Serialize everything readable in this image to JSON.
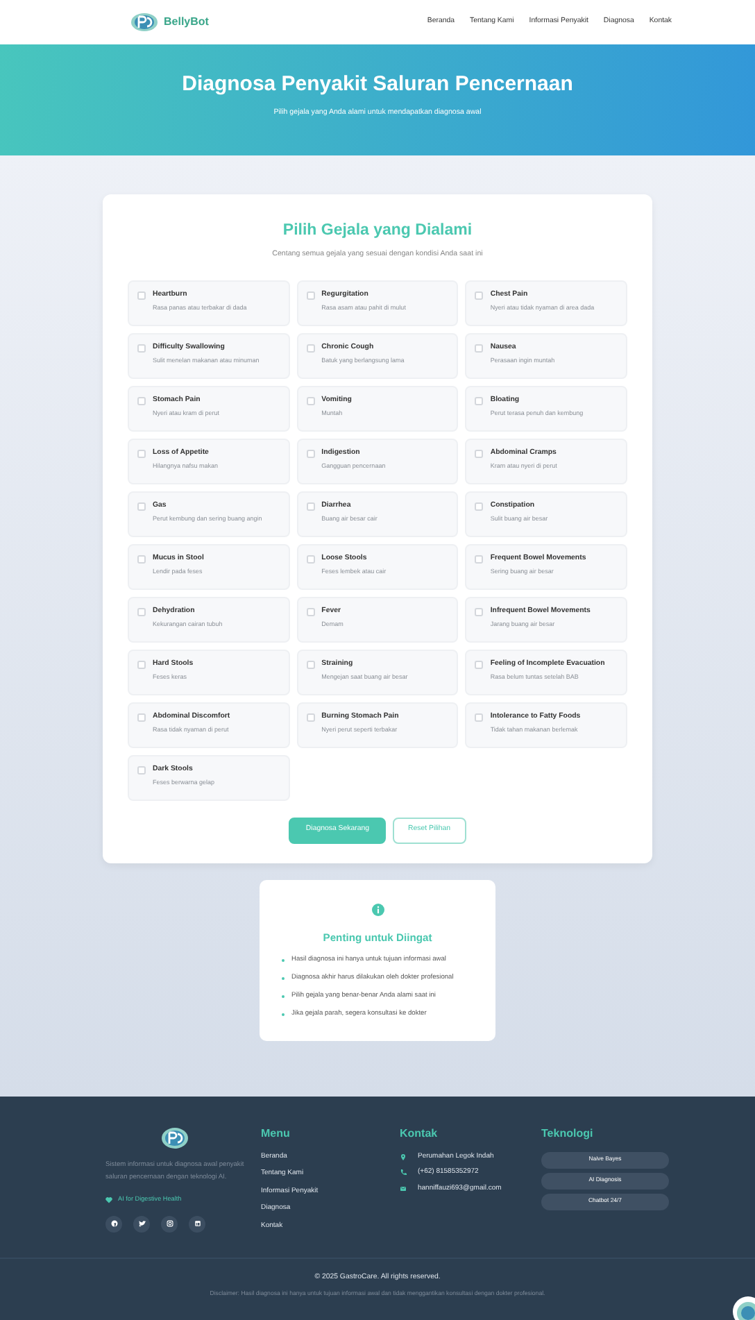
{
  "navbar": {
    "brand": "BellyBot",
    "links": [
      {
        "label": "Beranda",
        "selected": false
      },
      {
        "label": "Tentang Kami",
        "selected": false
      },
      {
        "label": "Informasi Penyakit",
        "selected": false
      },
      {
        "label": "Diagnosa",
        "selected": false
      },
      {
        "label": "Kontak",
        "selected": false
      }
    ]
  },
  "hero": {
    "title": "Diagnosa Penyakit Saluran Pencernaan",
    "subtitle": "Pilih gejala yang Anda alami untuk mendapatkan diagnosa awal"
  },
  "symptom_card": {
    "title": "Pilih Gejala yang Dialami",
    "subtitle": "Centang semua gejala yang sesuai dengan kondisi Anda saat ini",
    "symptoms": [
      {
        "name": "Heartburn",
        "description": "Rasa panas atau terbakar di dada",
        "checked": false
      },
      {
        "name": "Regurgitation",
        "description": "Rasa asam atau pahit di mulut",
        "checked": false
      },
      {
        "name": "Chest Pain",
        "description": "Nyeri atau tidak nyaman di area dada",
        "checked": false
      },
      {
        "name": "Difficulty Swallowing",
        "description": "Sulit menelan makanan atau minuman",
        "checked": false
      },
      {
        "name": "Chronic Cough",
        "description": "Batuk yang berlangsung lama",
        "checked": false
      },
      {
        "name": "Nausea",
        "description": "Perasaan ingin muntah",
        "checked": false
      },
      {
        "name": "Stomach Pain",
        "description": "Nyeri atau kram di perut",
        "checked": false
      },
      {
        "name": "Vomiting",
        "description": "Muntah",
        "checked": false
      },
      {
        "name": "Bloating",
        "description": "Perut terasa penuh dan kembung",
        "checked": false
      },
      {
        "name": "Loss of Appetite",
        "description": "Hilangnya nafsu makan",
        "checked": false
      },
      {
        "name": "Indigestion",
        "description": "Gangguan pencernaan",
        "checked": false
      },
      {
        "name": "Abdominal Cramps",
        "description": "Kram atau nyeri di perut",
        "checked": false
      },
      {
        "name": "Gas",
        "description": "Perut kembung dan sering buang angin",
        "checked": false
      },
      {
        "name": "Diarrhea",
        "description": "Buang air besar cair",
        "checked": false
      },
      {
        "name": "Constipation",
        "description": "Sulit buang air besar",
        "checked": false
      },
      {
        "name": "Mucus in Stool",
        "description": "Lendir pada feses",
        "checked": false
      },
      {
        "name": "Loose Stools",
        "description": "Feses lembek atau cair",
        "checked": false
      },
      {
        "name": "Frequent Bowel Movements",
        "description": "Sering buang air besar",
        "checked": false
      },
      {
        "name": "Dehydration",
        "description": "Kekurangan cairan tubuh",
        "checked": false
      },
      {
        "name": "Fever",
        "description": "Demam",
        "checked": false
      },
      {
        "name": "Infrequent Bowel Movements",
        "description": "Jarang buang air besar",
        "checked": false
      },
      {
        "name": "Hard Stools",
        "description": "Feses keras",
        "checked": false
      },
      {
        "name": "Straining",
        "description": "Mengejan saat buang air besar",
        "checked": false
      },
      {
        "name": "Feeling of Incomplete Evacuation",
        "description": "Rasa belum tuntas setelah BAB",
        "checked": false
      },
      {
        "name": "Abdominal Discomfort",
        "description": "Rasa tidak nyaman di perut",
        "checked": false
      },
      {
        "name": "Burning Stomach Pain",
        "description": "Nyeri perut seperti terbakar",
        "checked": false
      },
      {
        "name": "Intolerance to Fatty Foods",
        "description": "Tidak tahan makanan berlemak",
        "checked": false
      },
      {
        "name": "Dark Stools",
        "description": "Feses berwarna gelap",
        "checked": false
      }
    ],
    "buttons": [
      {
        "label": "Diagnosa Sekarang",
        "kind": "primary"
      },
      {
        "label": "Reset Pilihan",
        "kind": "outline"
      }
    ]
  },
  "info_card": {
    "title": "Penting untuk Diingat",
    "items": [
      "Hasil diagnosa ini hanya untuk tujuan informasi awal",
      "Diagnosa akhir harus dilakukan oleh dokter profesional",
      "Pilih gejala yang benar-benar Anda alami saat ini",
      "Jika gejala parah, segera konsultasi ke dokter"
    ]
  },
  "footer": {
    "about": "Sistem informasi untuk diagnosa awal penyakit saluran pencernaan dengan teknologi AI.",
    "tagline": "AI for Digestive Health",
    "menu": {
      "title": "Menu",
      "links": [
        "Beranda",
        "Tentang Kami",
        "Informasi Penyakit",
        "Diagnosa",
        "Kontak"
      ]
    },
    "contact": {
      "title": "Kontak",
      "items": [
        {
          "kind": "location",
          "text": "Perumahan Legok Indah"
        },
        {
          "kind": "phone",
          "text": "(+62) 81585352972"
        },
        {
          "kind": "email",
          "text": "hanniffauzi693@gmail.com"
        }
      ]
    },
    "technology": {
      "title": "Teknologi",
      "tags": [
        "Naive Bayes",
        "AI Diagnosis",
        "Chatbot 24/7"
      ]
    },
    "copyright": "© 2025 GastroCare. All rights reserved.",
    "disclaimer": "Disclaimer: Hasil diagnosa ini hanya untuk tujuan informasi awal dan tidak menggantikan konsultasi dengan dokter profesional."
  }
}
